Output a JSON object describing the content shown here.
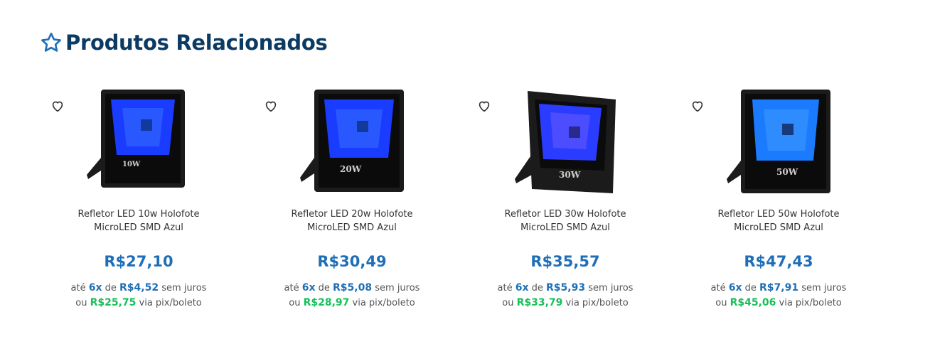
{
  "section": {
    "title": "Produtos Relacionados",
    "icon": "star-outline-icon",
    "accent": "#0b3a63"
  },
  "colors": {
    "price": "#1f6fb7",
    "pix": "#18c05a",
    "led": "#1a3cff"
  },
  "products": [
    {
      "name_line1": "Refletor LED 10w Holofote",
      "name_line2": "MicroLED SMD Azul",
      "price": "R$27,10",
      "inst_prefix": "até",
      "inst_count": "6x",
      "inst_mid": "de",
      "inst_value": "R$4,52",
      "inst_suffix": "sem juros",
      "pix_prefix": "ou",
      "pix_value": "R$25,75",
      "pix_suffix": "via pix/boleto",
      "watt_label": "10W"
    },
    {
      "name_line1": "Refletor LED 20w Holofote",
      "name_line2": "MicroLED SMD Azul",
      "price": "R$30,49",
      "inst_prefix": "até",
      "inst_count": "6x",
      "inst_mid": "de",
      "inst_value": "R$5,08",
      "inst_suffix": "sem juros",
      "pix_prefix": "ou",
      "pix_value": "R$28,97",
      "pix_suffix": "via pix/boleto",
      "watt_label": "20W"
    },
    {
      "name_line1": "Refletor LED 30w Holofote",
      "name_line2": "MicroLED SMD Azul",
      "price": "R$35,57",
      "inst_prefix": "até",
      "inst_count": "6x",
      "inst_mid": "de",
      "inst_value": "R$5,93",
      "inst_suffix": "sem juros",
      "pix_prefix": "ou",
      "pix_value": "R$33,79",
      "pix_suffix": "via pix/boleto",
      "watt_label": "30W"
    },
    {
      "name_line1": "Refletor LED 50w Holofote",
      "name_line2": "MicroLED SMD Azul",
      "price": "R$47,43",
      "inst_prefix": "até",
      "inst_count": "6x",
      "inst_mid": "de",
      "inst_value": "R$7,91",
      "inst_suffix": "sem juros",
      "pix_prefix": "ou",
      "pix_value": "R$45,06",
      "pix_suffix": "via pix/boleto",
      "watt_label": "50W"
    }
  ]
}
